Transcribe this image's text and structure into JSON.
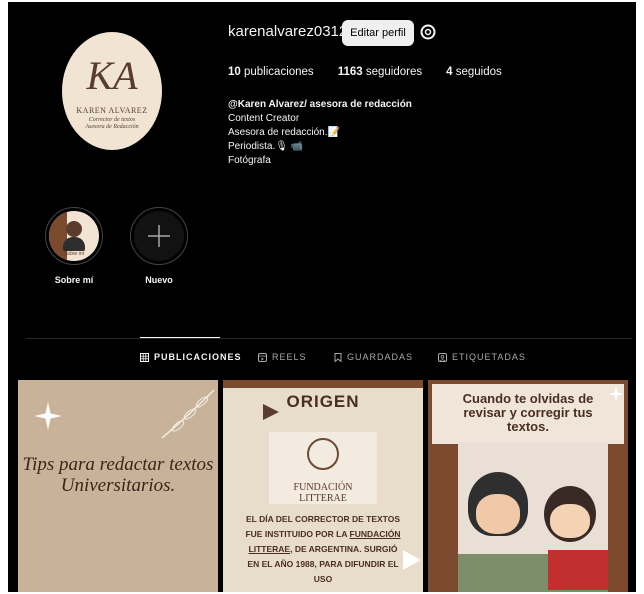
{
  "profile": {
    "username": "karenalvarez0312",
    "edit_label": "Editar perfil",
    "avatar": {
      "monogram": "KA",
      "brand": "KAREN ALVAREZ",
      "tagline": "Corrector de textos\nAsesora de Redacción"
    },
    "stats": [
      {
        "value": "10",
        "label": "publicaciones"
      },
      {
        "value": "1163",
        "label": "seguidores"
      },
      {
        "value": "4",
        "label": "seguidos"
      }
    ],
    "bio": {
      "name": "@Karen Alvarez/ asesora de redacción",
      "lines": [
        "Content Creator",
        "Asesora de redacción.📝",
        "Periodista.🎙 📹",
        "Fotógrafa"
      ]
    }
  },
  "highlights": [
    {
      "label": "Sobre mí",
      "inner_text": "Sobre mí"
    },
    {
      "label": "Nuevo"
    }
  ],
  "tabs": [
    {
      "label": "PUBLICACIONES",
      "icon": "grid-icon",
      "active": true
    },
    {
      "label": "REELS",
      "icon": "reels-icon"
    },
    {
      "label": "GUARDADAS",
      "icon": "bookmark-icon"
    },
    {
      "label": "ETIQUETADAS",
      "icon": "tag-icon"
    }
  ],
  "posts": [
    {
      "text": "Tips para redactar textos Universitarios."
    },
    {
      "title": "ORIGEN",
      "logo_text": "FUNDACIÓN LITTERAE",
      "body_1": "EL DÍA DEL CORRECTOR DE TEXTOS FUE INSTITUIDO POR LA ",
      "body_link": "FUNDACIÓN LITTERAE",
      "body_2": ", DE ARGENTINA. SURGIÓ EN EL AÑO 1988, PARA DIFUNDIR EL USO"
    },
    {
      "text": "Cuando te olvidas de revisar y corregir tus textos."
    }
  ],
  "colors": {
    "background": "#000000",
    "text": "#f5f5f5",
    "muted": "#a8a8a8",
    "avatar_bg": "#f1e4d3",
    "brown": "#7b4a2f"
  }
}
